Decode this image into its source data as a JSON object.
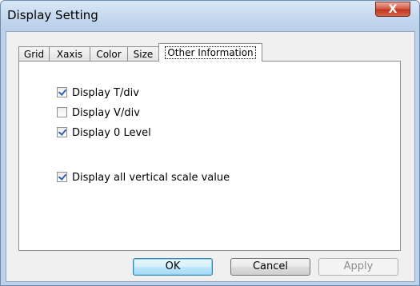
{
  "window": {
    "title": "Display Setting",
    "close_label": "X"
  },
  "tabs": [
    {
      "label": "Grid"
    },
    {
      "label": "Xaxis"
    },
    {
      "label": "Color"
    },
    {
      "label": "Size"
    },
    {
      "label": "Other Information",
      "selected": true
    }
  ],
  "options": [
    {
      "label": "Display T/div",
      "checked": true
    },
    {
      "label": "Display V/div",
      "checked": false
    },
    {
      "label": "Display 0 Level",
      "checked": true
    },
    {
      "label": "Display all vertical scale value",
      "checked": true
    }
  ],
  "buttons": {
    "ok": "OK",
    "cancel": "Cancel",
    "apply": "Apply"
  }
}
